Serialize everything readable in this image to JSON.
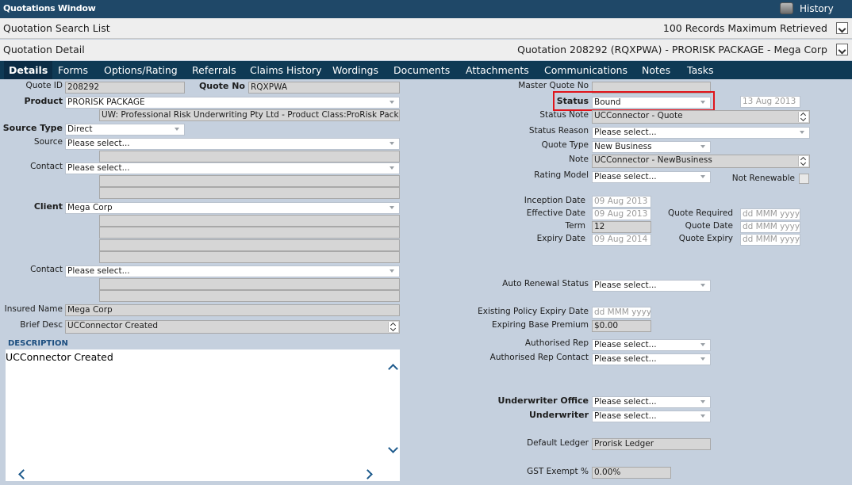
{
  "window": {
    "title": "Quotations Window",
    "history_label": "History"
  },
  "search_section": {
    "title": "Quotation Search List",
    "records_info": "100 Records Maximum Retrieved"
  },
  "detail_section": {
    "title": "Quotation Detail",
    "summary": "Quotation 208292 (RQXPWA) - PRORISK PACKAGE - Mega Corp"
  },
  "tabs": [
    "Details",
    "Forms",
    "Options/Rating",
    "Referrals",
    "Claims History",
    "Wordings",
    "Documents",
    "Attachments",
    "Communications",
    "Notes",
    "Tasks"
  ],
  "labels": {
    "quote_id": "Quote ID",
    "quote_no": "Quote No",
    "product": "Product",
    "source_type": "Source Type",
    "source": "Source",
    "contact": "Contact",
    "client": "Client",
    "contact2": "Contact",
    "insured_name": "Insured Name",
    "brief_desc": "Brief Desc",
    "description": "DESCRIPTION",
    "master_quote_no": "Master Quote No",
    "status": "Status",
    "status_note": "Status Note",
    "status_reason": "Status Reason",
    "quote_type": "Quote Type",
    "note": "Note",
    "rating_model": "Rating Model",
    "not_renewable": "Not Renewable",
    "inception_date": "Inception Date",
    "effective_date": "Effective Date",
    "term": "Term",
    "expiry_date": "Expiry Date",
    "quote_required": "Quote Required",
    "quote_date": "Quote Date",
    "quote_expiry": "Quote Expiry",
    "auto_renewal_status": "Auto Renewal Status",
    "existing_policy_expiry_date": "Existing Policy Expiry Date",
    "expiring_base_premium": "Expiring Base Premium",
    "authorised_rep": "Authorised Rep",
    "authorised_rep_contact": "Authorised Rep Contact",
    "underwriter_office": "Underwriter Office",
    "underwriter": "Underwriter",
    "default_ledger": "Default Ledger",
    "gst_exempt": "GST Exempt %"
  },
  "values": {
    "quote_id": "208292",
    "quote_no": "RQXPWA",
    "product": "PRORISK PACKAGE",
    "product_desc": "UW: Professional Risk Underwriting Pty Ltd - Product Class:ProRisk Package",
    "source_type": "Direct",
    "source": "Please select...",
    "contact": "Please select...",
    "client": "Mega Corp",
    "contact2": "Please select...",
    "insured_name": "Mega Corp",
    "brief_desc": "UCConnector Created",
    "description": "UCConnector Created",
    "master_quote_no": "",
    "status": "Bound",
    "status_date": "13 Aug 2013",
    "status_note": "UCConnector - Quote",
    "status_reason": "Please select...",
    "quote_type": "New Business",
    "note": "UCConnector - NewBusiness",
    "rating_model": "Please select...",
    "inception_date": "09 Aug 2013",
    "effective_date": "09 Aug 2013",
    "term": "12",
    "expiry_date": "09 Aug 2014",
    "quote_required": "dd MMM yyyy",
    "quote_date": "dd MMM yyyy",
    "quote_expiry": "dd MMM yyyy",
    "auto_renewal_status": "Please select...",
    "existing_policy_expiry_date": "dd MMM yyyy",
    "expiring_base_premium": "$0.00",
    "authorised_rep": "Please select...",
    "authorised_rep_contact": "Please select...",
    "underwriter_office": "Please select...",
    "underwriter": "Please select...",
    "default_ledger": "Prorisk Ledger",
    "gst_exempt": "0.00%"
  },
  "colors": {
    "background": "#c5d0de",
    "titlebar": "#1f4868",
    "tabbar": "#0f3a55",
    "highlight": "#e0141b",
    "description_title": "#1d4f80"
  }
}
